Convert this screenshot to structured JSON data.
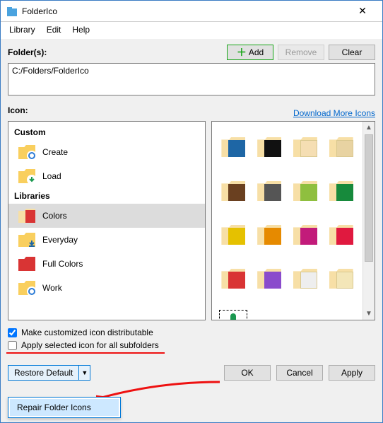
{
  "title": "FolderIco",
  "menu": {
    "library": "Library",
    "edit": "Edit",
    "help": "Help"
  },
  "folders_label": "Folder(s):",
  "buttons": {
    "add": "Add",
    "remove": "Remove",
    "clear": "Clear",
    "ok": "OK",
    "cancel": "Cancel",
    "apply": "Apply",
    "restore_default": "Restore Default",
    "repair_folder_icons": "Repair Folder Icons"
  },
  "folder_path": "C:/Folders/FolderIco",
  "icon_label": "Icon:",
  "download_link": "Download More Icons",
  "sidebar": {
    "custom_header": "Custom",
    "libraries_header": "Libraries",
    "custom_items": [
      {
        "label": "Create",
        "icon": "gear"
      },
      {
        "label": "Load",
        "icon": "download-green"
      }
    ],
    "library_items": [
      {
        "label": "Colors",
        "icon": "folder-red",
        "selected": true
      },
      {
        "label": "Everyday",
        "icon": "folder-download-blue"
      },
      {
        "label": "Full Colors",
        "icon": "folder-solid-red"
      },
      {
        "label": "Work",
        "icon": "gear"
      }
    ]
  },
  "icon_grid": [
    {
      "front": "#1e66a5"
    },
    {
      "front": "#111111"
    },
    {
      "front": "#f5deb3",
      "light": true
    },
    {
      "front": "#e8d3a2",
      "light": true
    },
    {
      "front": "#6a4020"
    },
    {
      "front": "#555555"
    },
    {
      "front": "#8fbf3f"
    },
    {
      "front": "#178a3c"
    },
    {
      "front": "#e5c100"
    },
    {
      "front": "#e68a00"
    },
    {
      "front": "#c21b7a"
    },
    {
      "front": "#e0193f"
    },
    {
      "front": "#d93434"
    },
    {
      "front": "#8a4bcc"
    },
    {
      "front": "#eeeeee",
      "light": true
    },
    {
      "front": "#f3e6b8",
      "light": true
    }
  ],
  "checks": {
    "distributable": "Make customized icon distributable",
    "subfolders": "Apply selected icon for all subfolders"
  },
  "chk_state": {
    "distributable": true,
    "subfolders": false
  }
}
